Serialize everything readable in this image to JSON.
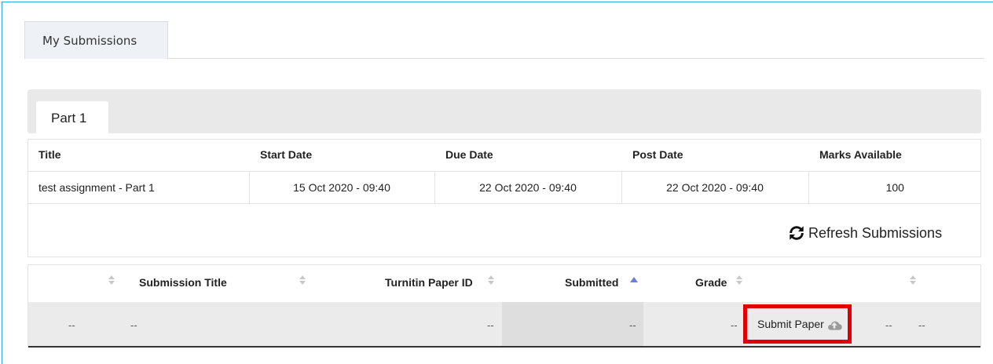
{
  "top_tabs": [
    {
      "label": "My Submissions"
    }
  ],
  "part_tab": {
    "label": "Part 1"
  },
  "info_table": {
    "headers": [
      "Title",
      "Start Date",
      "Due Date",
      "Post Date",
      "Marks Available"
    ],
    "row": [
      "test assignment - Part 1",
      "15 Oct 2020 - 09:40",
      "22 Oct 2020 - 09:40",
      "22 Oct 2020 - 09:40",
      "100"
    ]
  },
  "refresh": {
    "label": "Refresh Submissions",
    "icon": "refresh-icon"
  },
  "subs_table": {
    "headers": {
      "submission_title": "Submission Title",
      "paper_id": "Turnitin Paper ID",
      "submitted": "Submitted",
      "grade": "Grade"
    },
    "sorted_column": "Submitted",
    "sort_direction": "ascending",
    "row": {
      "col1": "--",
      "title": "--",
      "paper_id": "--",
      "submitted": "--",
      "grade": "--",
      "submit_label": "Submit Paper",
      "submit_icon": "cloud-upload-icon",
      "col_end1": "--",
      "col_end2": "--"
    }
  },
  "colors": {
    "frame_border": "#2aa6e0",
    "highlight_border": "#e00000",
    "sort_active": "#6b7fd8"
  }
}
